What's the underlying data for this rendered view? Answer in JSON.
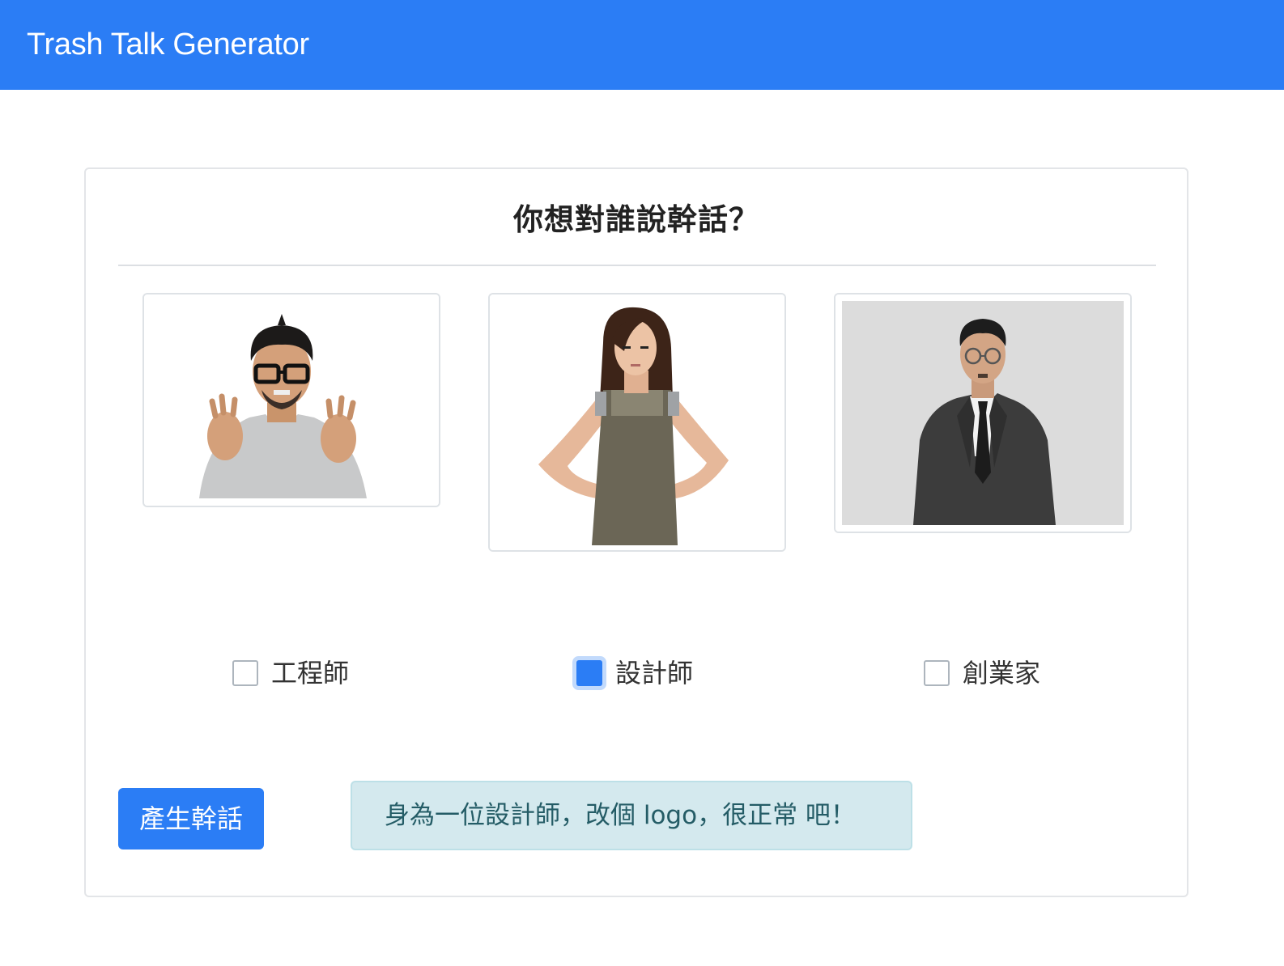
{
  "navbar": {
    "brand": "Trash Talk Generator",
    "background_color": "#2b7df5"
  },
  "card": {
    "question": "你想對誰說幹話？",
    "options": [
      {
        "label": "工程師",
        "checked": false,
        "image_icon": "engineer-photo"
      },
      {
        "label": "設計師",
        "checked": true,
        "image_icon": "designer-photo"
      },
      {
        "label": "創業家",
        "checked": false,
        "image_icon": "entrepreneur-photo"
      }
    ],
    "generate_button": "產生幹話",
    "result_text": "身為一位設計師，改個 logo，很正常 吧！"
  },
  "colors": {
    "primary": "#2b7df5",
    "result_bg": "#d4e9ee",
    "result_text": "#245c66"
  }
}
